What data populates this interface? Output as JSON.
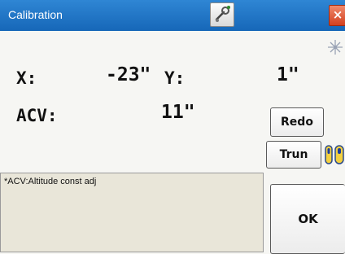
{
  "window": {
    "title": "Calibration",
    "close_label": "×",
    "icons": [
      "settings-icon",
      "close-icon",
      "star-icon",
      "bubble-level-icon"
    ],
    "accent_color": "#1f74c6"
  },
  "readings": {
    "x_label": "X:",
    "x_value": "-23\"",
    "y_label": "Y:",
    "y_value": "1\"",
    "acv_label": "ACV:",
    "acv_value": "11\""
  },
  "buttons": {
    "redo": "Redo",
    "trun": "Trun",
    "ok": "OK"
  },
  "note": {
    "text": "*ACV:Altitude const adj"
  }
}
